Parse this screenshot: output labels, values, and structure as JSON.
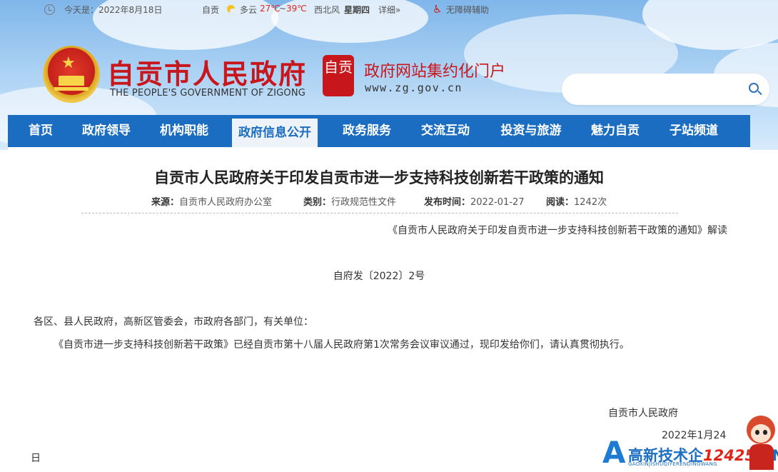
{
  "topbar": {
    "date": "今天是：2022年8月18日",
    "city": "自贡",
    "weather": "多云",
    "temp_low": "27℃",
    "temp_sep": "~",
    "temp_high": "39℃",
    "wind": "西北风",
    "weekday": "星期四",
    "detail_link": "详细»",
    "accessibility": "无障碍辅助"
  },
  "header": {
    "title": "自贡市人民政府",
    "title_en": "THE PEOPLE'S GOVERNMENT OF ZIGONG",
    "seal_text": "自贡",
    "portal_title": "政府网站集约化门户",
    "portal_url": "www.zg.gov.cn"
  },
  "search": {
    "placeholder": "",
    "value": ""
  },
  "nav": {
    "items": [
      {
        "label": "首页"
      },
      {
        "label": "政府领导"
      },
      {
        "label": "机构职能"
      },
      {
        "label": "政府信息公开",
        "active": true
      },
      {
        "label": "政务服务"
      },
      {
        "label": "交流互动"
      },
      {
        "label": "投资与旅游"
      },
      {
        "label": "魅力自贡"
      },
      {
        "label": "子站频道"
      }
    ]
  },
  "article": {
    "title": "自贡市人民政府关于印发自贡市进一步支持科技创新若干政策的通知",
    "meta": {
      "source_label": "来源：",
      "source": "自贡市人民政府办公室",
      "category_label": "类别：",
      "category": "行政规范性文件",
      "date_label": "发布时间：",
      "date": "2022-01-27",
      "reads_label": "阅读：",
      "reads": "1242次"
    },
    "interpretation_link": "《自贡市人民政府关于印发自贡市进一步支持科技创新若干政策的通知》解读",
    "doc_number": "自府发〔2022〕2号",
    "addressee": "各区、县人民政府，高新区管委会，市政府各部门，有关单位：",
    "body": "《自贡市进一步支持科技创新若干政策》已经自贡市第十八届人民政府第1次常务会议审议通过，现印发给你们，请认真贯彻执行。",
    "signature": "自贡市人民政府",
    "sign_date": "2022年1月24",
    "sign_date_tail": "日"
  },
  "watermark": {
    "badge": "A",
    "brand": "高新技术企",
    "brand_num": "12425",
    "brand_tail": ".CN",
    "sub": "GAOXINJISHUQIYERENDINGWANG"
  },
  "colors": {
    "nav_blue": "#1a6dc0",
    "brand_red": "#c8161d",
    "active_tab_bg": "#eef3fa"
  }
}
